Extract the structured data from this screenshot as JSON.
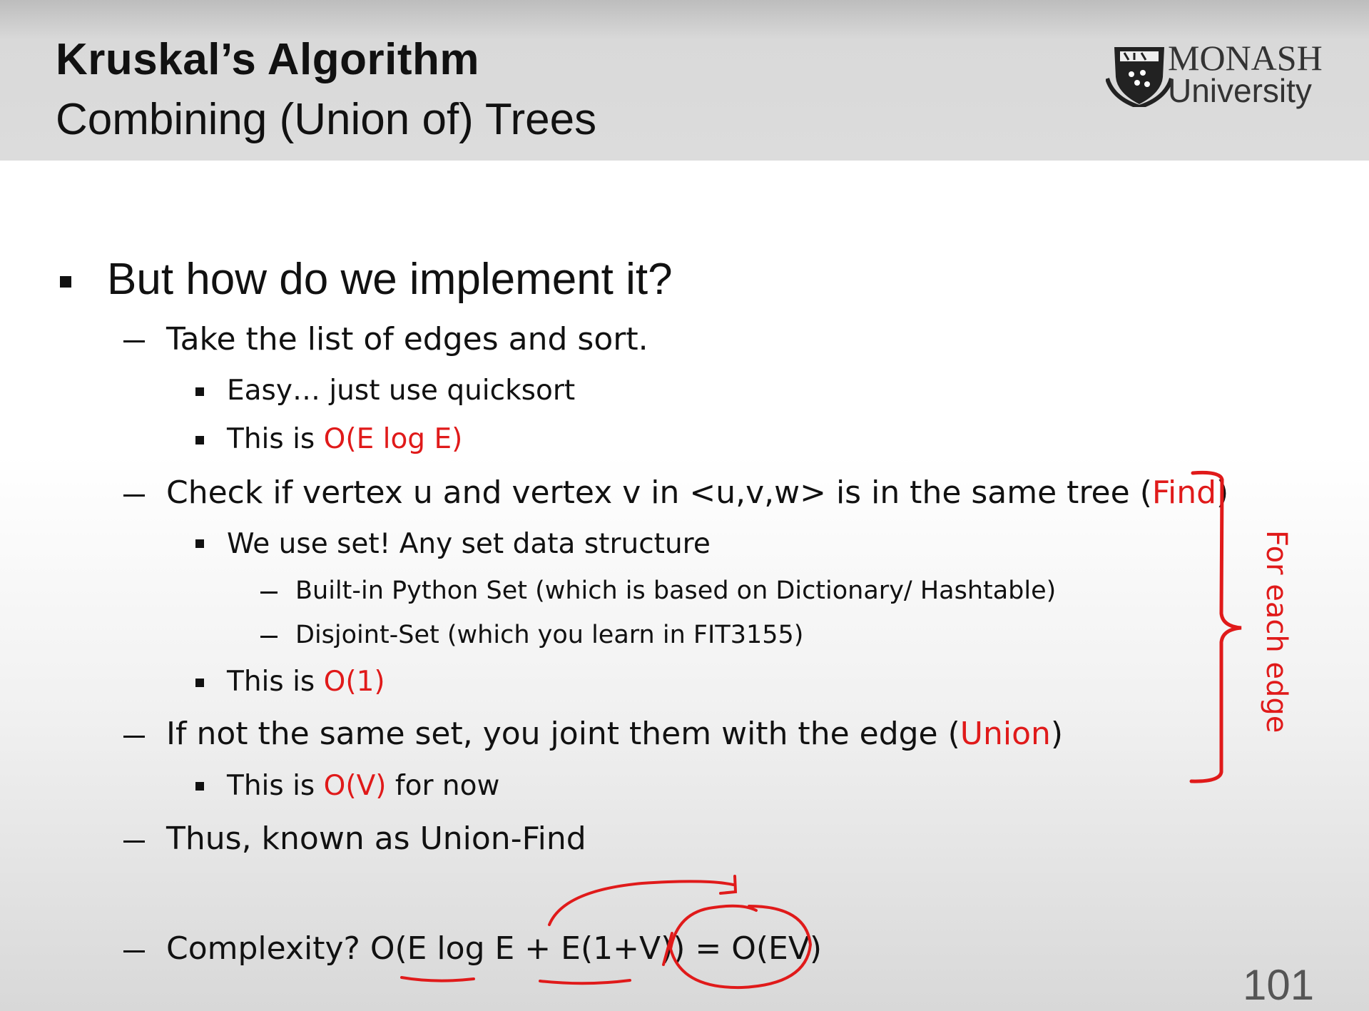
{
  "header": {
    "title": "Kruskal’s Algorithm",
    "subtitle": "Combining (Union of) Trees",
    "logo_line1": "MONASH",
    "logo_line2": "University",
    "logo_icon": "monash-crest-icon"
  },
  "body": {
    "q": "But how do we implement it?",
    "sort": "Take the list of edges and sort.",
    "easy": "Easy… just use quicksort",
    "this_is": "This is ",
    "c_sort": "O(E log E)",
    "check_a": "Check if vertex u and vertex v in <u,v,w> is in the same tree (",
    "find": "Find",
    "close_paren": ")",
    "set_use": "We use set! Any set data structure",
    "py_set": "Built-in Python Set (which is based on Dictionary/ Hashtable)",
    "disjoint": "Disjoint-Set (which you learn in FIT3155)",
    "c_find": "O(1)",
    "union_a": "If not the same set, you joint them with the edge (",
    "union": "Union",
    "c_union": "O(V)",
    "for_now": " for now",
    "thus": "Thus, known as Union-Find",
    "complexity": "Complexity? O(E log E + E(1+V)) = O(EV)"
  },
  "annotation": {
    "brace_label": "For each edge",
    "ink_color": "#e01a1a"
  },
  "page_number": "101"
}
